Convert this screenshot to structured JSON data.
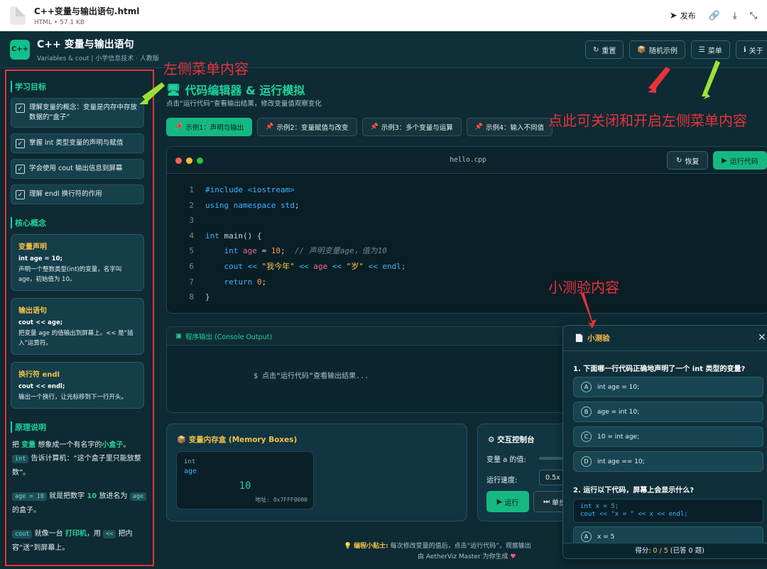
{
  "file": {
    "name": "C++变量与输出语句.html",
    "meta": "HTML • 57.1 KB"
  },
  "file_actions": {
    "publish": "发布"
  },
  "app": {
    "logo": "C++",
    "title": "C++ 变量与输出语句",
    "subtitle": "Variables & cout | 小学信息技术 · 人教版"
  },
  "header_buttons": [
    {
      "icon": "↻",
      "label": "重置"
    },
    {
      "icon": "📦",
      "label": "随机示例"
    },
    {
      "icon": "☰",
      "label": "菜单"
    },
    {
      "icon": "ℹ",
      "label": "关于"
    }
  ],
  "sidebar": {
    "goals_title": "学习目标",
    "goals": [
      "理解变量的概念：变量是内存中存放数据的“盒子”",
      "掌握 int 类型变量的声明与赋值",
      "学会使用 cout 输出信息到屏幕",
      "理解 endl 换行符的作用"
    ],
    "concepts_title": "核心概念",
    "concepts": [
      {
        "title": "变量声明",
        "code": "int age = 10;",
        "desc": "声明一个整数类型(int)的变量，名字叫age，初始值为 10。"
      },
      {
        "title": "输出语句",
        "code": "cout << age;",
        "desc": "把变量 age 的值输出到屏幕上。<< 是“插入”运算符。"
      },
      {
        "title": "换行符 endl",
        "code": "cout << endl;",
        "desc": "输出一个换行，让光标移到下一行开头。"
      }
    ],
    "principle_title": "原理说明",
    "principle": {
      "p1_a": "把",
      "p1_hl1": "变量",
      "p1_b": "想象成一个有名字的",
      "p1_hl2": "小盒子",
      "p1_c": "。",
      "p1_tag": "int",
      "p1_d": "告诉计算机：“这个盒子里只能放整数”。",
      "p2_tag1": "age = 10",
      "p2_a": "就是把数字",
      "p2_hl": "10",
      "p2_b": "放进名为",
      "p2_tag2": "age",
      "p2_c": "的盒子。",
      "p3_tag1": "cout",
      "p3_a": "就像一台",
      "p3_hl": "打印机",
      "p3_b": "，用",
      "p3_tag2": "<<",
      "p3_c": "把内容“送”到屏幕上。"
    }
  },
  "main": {
    "title_icon": "🖥",
    "title": "代码编辑器 & 运行模拟",
    "subtitle": "点击“运行代码”查看输出结果，修改变量值观察变化",
    "example_tabs": [
      {
        "label": "示例1：声明与输出",
        "active": true
      },
      {
        "label": "示例2：变量赋值与改变",
        "active": false
      },
      {
        "label": "示例3：多个变量与运算",
        "active": false
      },
      {
        "label": "示例4：输入不同值",
        "active": false
      }
    ],
    "editor": {
      "filename": "hello.cpp",
      "restore_label": "恢复",
      "run_label": "运行代码",
      "lines": [
        "1",
        "2",
        "3",
        "4",
        "5",
        "6",
        "7",
        "8"
      ],
      "code": {
        "l1_a": "#include ",
        "l1_b": "<iostream>",
        "l2_a": "using namespace ",
        "l2_b": "std",
        "l2_c": ";",
        "l4_a": "int ",
        "l4_b": "main",
        "l4_c": "() {",
        "l5_a": "    int ",
        "l5_b": "age",
        "l5_c": " = ",
        "l5_d": "10",
        "l5_e": ";  ",
        "l5_f": "// 声明变量age，值为10",
        "l6_a": "    cout << ",
        "l6_b": "\"我今年\"",
        "l6_c": " << ",
        "l6_d": "age",
        "l6_e": " << ",
        "l6_f": "\"岁\"",
        "l6_g": " << endl;",
        "l7_a": "    return ",
        "l7_b": "0",
        "l7_c": ";",
        "l8_a": "}"
      }
    },
    "console": {
      "title": "程序输出 (Console Output)",
      "placeholder": "$ 点击“运行代码”查看输出结果..."
    },
    "memory": {
      "title": "变量内存盒 (Memory Boxes)",
      "type": "int",
      "name": "age",
      "value": "10",
      "address": "地址: 0x7FFF0000"
    },
    "control": {
      "title": "交互控制台",
      "var_label": "变量 a 的值:",
      "speed_label": "运行速度:",
      "speed_value": "0.5x",
      "run_label": "运行",
      "step_label": "单步"
    },
    "tip": {
      "label": "编程小贴士:",
      "text": "每次修改变量的值后，点击“运行代码”，观察输出"
    },
    "credit": "由 AetherViz Master 为你生成"
  },
  "quiz": {
    "title": "小测验",
    "q1": "1. 下面哪一行代码正确地声明了一个 int 类型的变量?",
    "q1_options": [
      {
        "letter": "A",
        "text": "int age = 10;"
      },
      {
        "letter": "B",
        "text": "age = int 10;"
      },
      {
        "letter": "C",
        "text": "10 = int age;"
      },
      {
        "letter": "D",
        "text": "int age == 10;"
      }
    ],
    "q2": "2. 运行以下代码，屏幕上会显示什么?",
    "q2_code_1": "int x = 5;",
    "q2_code_2": "cout << \"x = \" << x << endl;",
    "q2_options": [
      {
        "letter": "A",
        "text": "x = 5"
      }
    ],
    "score_label": "得分:",
    "score_value": "0 / 5",
    "score_suffix": "(已答 0 题)"
  },
  "annotations": {
    "left_menu": "左侧菜单内容",
    "toggle_menu": "点此可关闭和开启左侧菜单内容",
    "quiz": "小测验内容"
  },
  "colors": {
    "accent": "#1fd29a",
    "annotation": "#e8323a",
    "warning": "#f5c145",
    "bg": "#0e2a33"
  }
}
